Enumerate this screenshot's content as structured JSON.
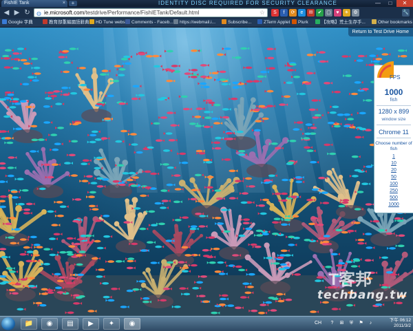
{
  "window": {
    "tab_title": "FishIE Tank",
    "banner": "IDENTITY DISC REQUIRED FOR SECURITY CLEARANCE",
    "tab_close": "×",
    "new_tab": "+",
    "minimize": "—",
    "maximize": "□",
    "close": "✕"
  },
  "toolbar": {
    "back": "◀",
    "forward": "▶",
    "reload": "↻",
    "url_domain": "ie.microsoft.com",
    "url_path": "/testdrive/Performance/FishIETank/Default.html",
    "star": "☆",
    "extensions": [
      {
        "label": "S",
        "color": "#d33"
      },
      {
        "label": "f",
        "color": "#2a5db0"
      },
      {
        "label": "⟳",
        "color": "#e08a1e"
      },
      {
        "label": "e",
        "color": "#1b8de0"
      },
      {
        "label": "✉",
        "color": "#c0392b"
      },
      {
        "label": "✔",
        "color": "#27a04a"
      },
      {
        "label": "▢",
        "color": "#6a7d8f"
      },
      {
        "label": "♥",
        "color": "#d6417a"
      },
      {
        "label": "☀",
        "color": "#e0a91e"
      },
      {
        "label": "⚙",
        "color": "#7b8c9d"
      }
    ]
  },
  "bookmarks": [
    {
      "label": "Google 字典",
      "color": "#3a7bd5"
    },
    {
      "label": "教育部重編國語辭典",
      "color": "#c0392b"
    },
    {
      "label": "HD Tune website",
      "color": "#e0a91e"
    },
    {
      "label": "Comments - Faceb...",
      "color": "#3b5998"
    },
    {
      "label": "https://webmail.i...",
      "color": "#6a7d8f"
    },
    {
      "label": "Subscribe...",
      "color": "#e08a1e"
    },
    {
      "label": "ZTerm Applet",
      "color": "#2a5db0"
    },
    {
      "label": "Plurk",
      "color": "#d35400"
    },
    {
      "label": "【攻略】荒土生存手...",
      "color": "#27ae60"
    },
    {
      "label": "Other bookmarks",
      "color": "#d4b04a"
    }
  ],
  "page": {
    "return_link": "Return to Test Drive Home"
  },
  "panel": {
    "fps_label": "FPS",
    "fish_count": "1000",
    "fish_label": "fish",
    "window_size": "1280 x 899",
    "window_size_label": "window size",
    "browser": "Chrome 11",
    "choose_label": "Choose number of fish",
    "options": [
      "1",
      "10",
      "20",
      "50",
      "100",
      "250",
      "500",
      "1000"
    ]
  },
  "taskbar": {
    "buttons": [
      {
        "name": "explorer",
        "icon": "📁"
      },
      {
        "name": "chrome",
        "icon": "◉"
      },
      {
        "name": "folder",
        "icon": "▤"
      },
      {
        "name": "media",
        "icon": "▶"
      },
      {
        "name": "app",
        "icon": "✦"
      },
      {
        "name": "chrome-active",
        "icon": "◉"
      }
    ],
    "lang": "CH",
    "time": "下午 06:12",
    "date": "2011/3/2"
  },
  "watermark": {
    "site": "techbang.tw",
    "logo": "T客邦"
  },
  "colors": {
    "water_top": "#2f8fc5",
    "water_bottom": "#0d3350",
    "panel_text": "#1a55a0"
  }
}
